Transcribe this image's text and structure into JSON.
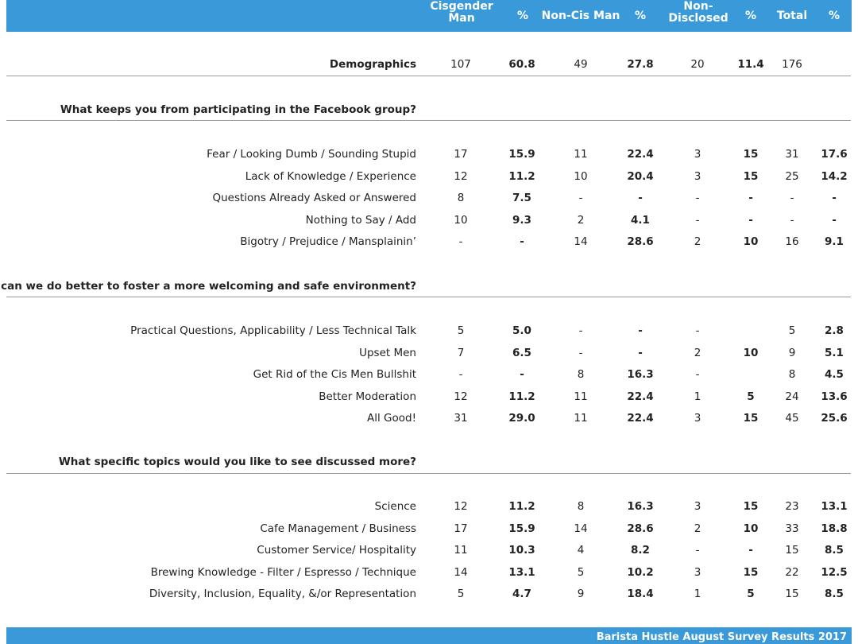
{
  "header": {
    "columns": [
      "Cisgender Man",
      "%",
      "Non-Cis Man",
      "%",
      "Non-Disclosed",
      "%",
      "Total",
      "%"
    ]
  },
  "demographics": {
    "label": "Demographics",
    "values": [
      "107",
      "60.8",
      "49",
      "27.8",
      "20",
      "11.4",
      "176",
      ""
    ]
  },
  "sections": [
    {
      "title": "What keeps you from participating in the Facebook group?",
      "rows": [
        {
          "label": "Fear / Looking Dumb / Sounding Stupid",
          "values": [
            "17",
            "15.9",
            "11",
            "22.4",
            "3",
            "15",
            "31",
            "17.6"
          ]
        },
        {
          "label": "Lack of Knowledge / Experience",
          "values": [
            "12",
            "11.2",
            "10",
            "20.4",
            "3",
            "15",
            "25",
            "14.2"
          ]
        },
        {
          "label": "Questions Already Asked or Answered",
          "values": [
            "8",
            "7.5",
            "-",
            "-",
            "-",
            "-",
            "-",
            "-"
          ]
        },
        {
          "label": "Nothing to Say / Add",
          "values": [
            "10",
            "9.3",
            "2",
            "4.1",
            "-",
            "-",
            "-",
            "-"
          ]
        },
        {
          "label": "Bigotry / Prejudice / Mansplainin’",
          "values": [
            "-",
            "-",
            "14",
            "28.6",
            "2",
            "10",
            "16",
            "9.1"
          ]
        }
      ]
    },
    {
      "title": "What can we do better to foster a more welcoming and safe environment?",
      "rows": [
        {
          "label": "Practical Questions, Applicability / Less Technical Talk",
          "values": [
            "5",
            "5.0",
            "-",
            "-",
            "-",
            "",
            "5",
            "2.8"
          ]
        },
        {
          "label": "Upset Men",
          "values": [
            "7",
            "6.5",
            "-",
            "-",
            "2",
            "10",
            "9",
            "5.1"
          ]
        },
        {
          "label": "Get Rid of the Cis Men Bullshit",
          "values": [
            "-",
            "-",
            "8",
            "16.3",
            "-",
            "",
            "8",
            "4.5"
          ]
        },
        {
          "label": "Better Moderation",
          "values": [
            "12",
            "11.2",
            "11",
            "22.4",
            "1",
            "5",
            "24",
            "13.6"
          ]
        },
        {
          "label": "All Good!",
          "values": [
            "31",
            "29.0",
            "11",
            "22.4",
            "3",
            "15",
            "45",
            "25.6"
          ]
        }
      ]
    },
    {
      "title": "What specific topics would you like to see discussed more?",
      "rows": [
        {
          "label": "Science",
          "values": [
            "12",
            "11.2",
            "8",
            "16.3",
            "3",
            "15",
            "23",
            "13.1"
          ]
        },
        {
          "label": "Cafe Management / Business",
          "values": [
            "17",
            "15.9",
            "14",
            "28.6",
            "2",
            "10",
            "33",
            "18.8"
          ]
        },
        {
          "label": "Customer Service/ Hospitality",
          "values": [
            "11",
            "10.3",
            "4",
            "8.2",
            "-",
            "-",
            "15",
            "8.5"
          ]
        },
        {
          "label": "Brewing Knowledge - Filter / Espresso / Technique",
          "values": [
            "14",
            "13.1",
            "5",
            "10.2",
            "3",
            "15",
            "22",
            "12.5"
          ]
        },
        {
          "label": "Diversity, Inclusion, Equality, &/or Representation",
          "values": [
            "5",
            "4.7",
            "9",
            "18.4",
            "1",
            "5",
            "15",
            "8.5"
          ]
        }
      ]
    }
  ],
  "footer": {
    "text": "Barista Hustle August Survey Results 2017"
  },
  "colors": {
    "band": "#3a9ad9",
    "rule": "#9a9a9a"
  }
}
